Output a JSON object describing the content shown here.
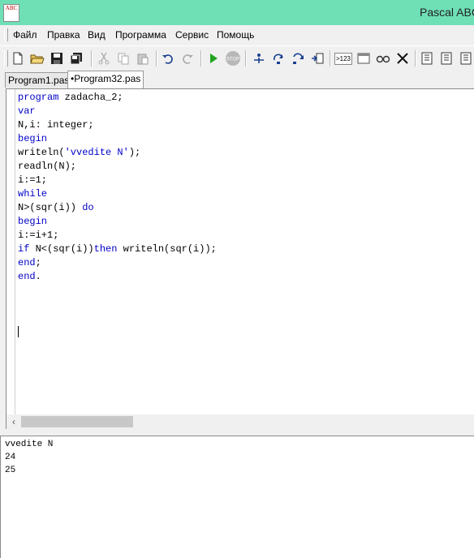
{
  "window": {
    "title": "Pascal ABC",
    "icon_text": "ABC"
  },
  "menu": [
    {
      "label": "Файл"
    },
    {
      "label": "Правка"
    },
    {
      "label": "Вид"
    },
    {
      "label": "Программа"
    },
    {
      "label": "Сервис"
    },
    {
      "label": "Помощь"
    }
  ],
  "toolbar": [
    {
      "name": "new-file-icon"
    },
    {
      "name": "open-folder-icon"
    },
    {
      "name": "save-icon"
    },
    {
      "name": "save-all-icon"
    },
    {
      "name": "cut-icon"
    },
    {
      "name": "copy-icon"
    },
    {
      "name": "paste-icon"
    },
    {
      "name": "undo-icon"
    },
    {
      "name": "redo-icon"
    },
    {
      "name": "run-icon"
    },
    {
      "name": "stop-icon"
    },
    {
      "name": "step-into-icon"
    },
    {
      "name": "step-over-icon"
    },
    {
      "name": "step-out-icon"
    },
    {
      "name": "run-to-cursor-icon"
    },
    {
      "name": "evaluate-icon"
    },
    {
      "name": "output-window-icon"
    },
    {
      "name": "watch-icon"
    },
    {
      "name": "close-icon"
    },
    {
      "name": "doc-1-icon"
    },
    {
      "name": "doc-2-icon"
    },
    {
      "name": "doc-3-icon"
    }
  ],
  "toolbar_labels": {
    "evaluate": ">123",
    "stop": "STOP"
  },
  "tabs": [
    {
      "label": "Program1.pas",
      "active": false
    },
    {
      "label": "•Program32.pas",
      "active": true
    }
  ],
  "code_lines": [
    [
      {
        "t": "program",
        "c": "kw"
      },
      {
        "t": " zadacha_2;",
        "c": ""
      }
    ],
    [
      {
        "t": "var",
        "c": "kw"
      }
    ],
    [
      {
        "t": "N,i: integer;",
        "c": ""
      }
    ],
    [
      {
        "t": "begin",
        "c": "kw"
      }
    ],
    [
      {
        "t": "writeln(",
        "c": ""
      },
      {
        "t": "'vvedite N'",
        "c": "str"
      },
      {
        "t": ");",
        "c": ""
      }
    ],
    [
      {
        "t": "readln(N);",
        "c": ""
      }
    ],
    [
      {
        "t": "i:=1;",
        "c": ""
      }
    ],
    [
      {
        "t": "while",
        "c": "kw"
      }
    ],
    [
      {
        "t": "N>(sqr(i)) ",
        "c": ""
      },
      {
        "t": "do",
        "c": "kw"
      }
    ],
    [
      {
        "t": "begin",
        "c": "kw"
      }
    ],
    [
      {
        "t": "i:=i+1;",
        "c": ""
      }
    ],
    [
      {
        "t": "if",
        "c": "kw"
      },
      {
        "t": " N<(sqr(i))",
        "c": ""
      },
      {
        "t": "then",
        "c": "kw"
      },
      {
        "t": " writeln(sqr(i));",
        "c": ""
      }
    ],
    [
      {
        "t": "end",
        "c": "kw"
      },
      {
        "t": ";",
        "c": ""
      }
    ],
    [
      {
        "t": "end",
        "c": "kw"
      },
      {
        "t": ".",
        "c": ""
      }
    ]
  ],
  "output_lines": [
    "vvedite N",
    "24",
    "25"
  ],
  "colors": {
    "titlebar": "#6fe0b6",
    "keyword": "#0000c8"
  }
}
